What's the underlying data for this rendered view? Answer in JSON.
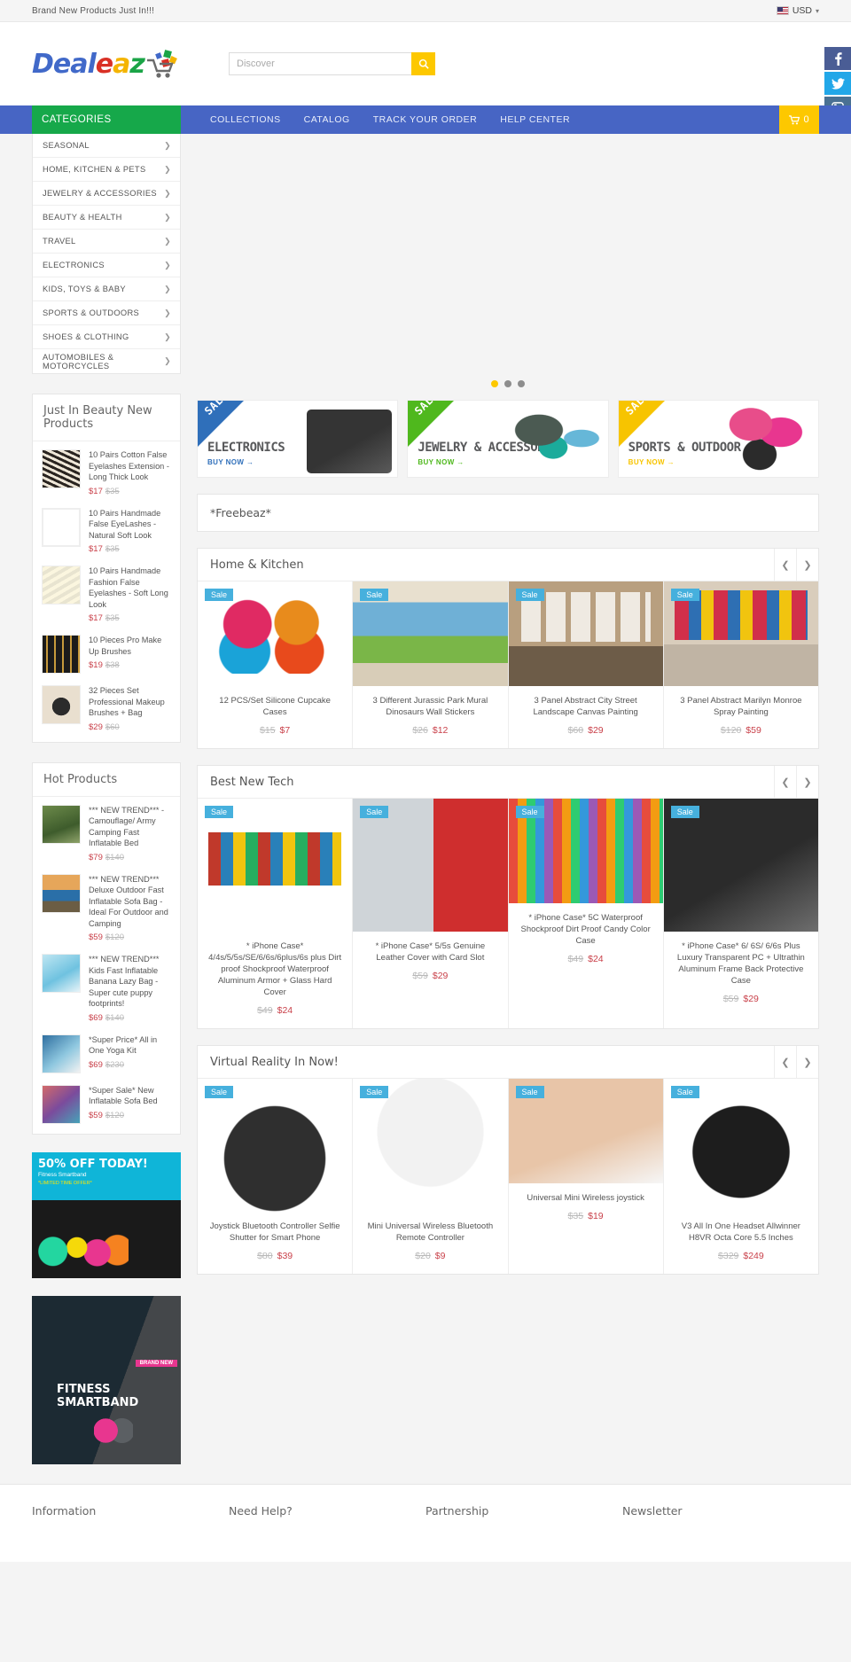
{
  "topbar": {
    "promo": "Brand New Products Just In!!!",
    "currency": "USD",
    "flag_icon": "us-flag-icon"
  },
  "header": {
    "logo_parts": [
      "D",
      "eal",
      "e",
      "a",
      "z"
    ],
    "logo_alt": "Dealeaz",
    "search": {
      "placeholder": "Discover",
      "value": "",
      "button_icon": "search-icon"
    },
    "social": [
      {
        "name": "facebook",
        "glyph": "f",
        "color": "#4a5d95"
      },
      {
        "name": "twitter",
        "glyph": "t",
        "color": "#22a7e8"
      },
      {
        "name": "instagram",
        "glyph": "ig",
        "color": "#4a7193"
      }
    ]
  },
  "nav": {
    "categories_label": "CATEGORIES",
    "links": [
      "COLLECTIONS",
      "CATALOG",
      "TRACK YOUR ORDER",
      "HELP CENTER"
    ],
    "cart_count": "0",
    "cart_icon": "shopping-cart-icon"
  },
  "categories": [
    "SEASONAL",
    "HOME, KITCHEN & PETS",
    "JEWELRY & ACCESSORIES",
    "BEAUTY & HEALTH",
    "TRAVEL",
    "ELECTRONICS",
    "KIDS, TOYS & BABY",
    "SPORTS & OUTDOORS",
    "SHOES & CLOTHING",
    "AUTOMOBILES & MOTORCYCLES"
  ],
  "sidebar": {
    "beauty": {
      "title": "Just In Beauty New Products",
      "items": [
        {
          "name": "10 Pairs Cotton False Eyelashes Extension - Long Thick Look",
          "price": "$17",
          "old": "$35"
        },
        {
          "name": "10 Pairs Handmade False EyeLashes - Natural Soft Look",
          "price": "$17",
          "old": "$35"
        },
        {
          "name": "10 Pairs Handmade Fashion False Eyelashes - Soft Long Look",
          "price": "$17",
          "old": "$35"
        },
        {
          "name": "10 Pieces Pro Make Up Brushes",
          "price": "$19",
          "old": "$38"
        },
        {
          "name": "32 Pieces Set Professional Makeup Brushes + Bag",
          "price": "$29",
          "old": "$60"
        }
      ]
    },
    "hot": {
      "title": "Hot Products",
      "items": [
        {
          "name": "*** NEW TREND*** - Camouflage/ Army Camping Fast Inflatable Bed",
          "price": "$79",
          "old": "$140"
        },
        {
          "name": "*** NEW TREND*** Deluxe Outdoor Fast Inflatable Sofa Bag - Ideal For Outdoor and Camping",
          "price": "$59",
          "old": "$120"
        },
        {
          "name": "*** NEW TREND*** Kids Fast Inflatable Banana Lazy Bag - Super cute puppy footprints!",
          "price": "$69",
          "old": "$140"
        },
        {
          "name": "*Super Price* All in One Yoga Kit",
          "price": "$69",
          "old": "$230"
        },
        {
          "name": "*Super Sale* New Inflatable Sofa Bed",
          "price": "$59",
          "old": "$120"
        }
      ]
    },
    "banners": [
      {
        "name": "fitness-smartband-50-off-banner",
        "headline": "50% OFF TODAY!",
        "sub": "Fitness Smartband",
        "note": "*LIMITED TIME OFFER*"
      },
      {
        "name": "fitness-smartband-brand-new-banner",
        "headline": "FITNESS SMARTBAND",
        "sub": "BRAND NEW"
      }
    ]
  },
  "slider": {
    "dots": 3,
    "active_dot": 0
  },
  "promos": [
    {
      "tag": "SALE",
      "title": "ELECTRONICS",
      "cta": "BUY NOW",
      "color": "blue"
    },
    {
      "tag": "SALE",
      "title": "JEWELRY & ACCESSORIES",
      "cta": "BUY NOW",
      "color": "green"
    },
    {
      "tag": "SALE",
      "title": "SPORTS & OUTDOOR",
      "cta": "BUY NOW",
      "color": "yellow"
    }
  ],
  "freebeaz_title": "*Freebeaz*",
  "sections": [
    {
      "title": "Home & Kitchen",
      "prev_icon": "chevron-left-icon",
      "next_icon": "chevron-right-icon",
      "products": [
        {
          "badge": "Sale",
          "name": "12 PCS/Set Silicone Cupcake Cases",
          "old": "$15",
          "price": "$7"
        },
        {
          "badge": "Sale",
          "name": "3 Different Jurassic Park Mural Dinosaurs Wall Stickers",
          "old": "$26",
          "price": "$12"
        },
        {
          "badge": "Sale",
          "name": "3 Panel Abstract City Street Landscape Canvas Painting",
          "old": "$60",
          "price": "$29"
        },
        {
          "badge": "Sale",
          "name": "3 Panel Abstract Marilyn Monroe Spray Painting",
          "old": "$120",
          "price": "$59"
        }
      ]
    },
    {
      "title": "Best New Tech",
      "prev_icon": "chevron-left-icon",
      "next_icon": "chevron-right-icon",
      "products": [
        {
          "badge": "Sale",
          "name": "* iPhone Case* 4/4s/5/5s/SE/6/6s/6plus/6s plus Dirt proof Shockproof Waterproof Aluminum Armor + Glass Hard Cover",
          "old": "$49",
          "price": "$24"
        },
        {
          "badge": "Sale",
          "name": "* iPhone Case* 5/5s Genuine Leather Cover with Card Slot",
          "old": "$59",
          "price": "$29"
        },
        {
          "badge": "Sale",
          "name": "* iPhone Case* 5C Waterproof Shockproof Dirt Proof Candy Color Case",
          "old": "$49",
          "price": "$24"
        },
        {
          "badge": "Sale",
          "name": "* iPhone Case* 6/ 6S/ 6/6s Plus Luxury Transparent PC + Ultrathin Aluminum Frame Back Protective Case",
          "old": "$59",
          "price": "$29"
        }
      ]
    },
    {
      "title": "Virtual Reality In Now!",
      "prev_icon": "chevron-left-icon",
      "next_icon": "chevron-right-icon",
      "products": [
        {
          "badge": "Sale",
          "name": "Joystick Bluetooth Controller Selfie Shutter for Smart Phone",
          "old": "$80",
          "price": "$39"
        },
        {
          "badge": "Sale",
          "name": "Mini Universal Wireless Bluetooth Remote Controller",
          "old": "$20",
          "price": "$9"
        },
        {
          "badge": "Sale",
          "name": "Universal Mini Wireless joystick",
          "old": "$35",
          "price": "$19"
        },
        {
          "badge": "Sale",
          "name": "V3 All In One Headset Allwinner H8VR Octa Core 5.5 Inches",
          "old": "$329",
          "price": "$249"
        }
      ]
    }
  ],
  "footer": {
    "columns": [
      "Information",
      "Need Help?",
      "Partnership",
      "Newsletter"
    ]
  },
  "colors": {
    "nav_blue": "#4765c4",
    "category_green": "#16a84a",
    "accent_yellow": "#fdc800",
    "sale_blue": "#46b0dd",
    "price_red": "#c9414a"
  }
}
